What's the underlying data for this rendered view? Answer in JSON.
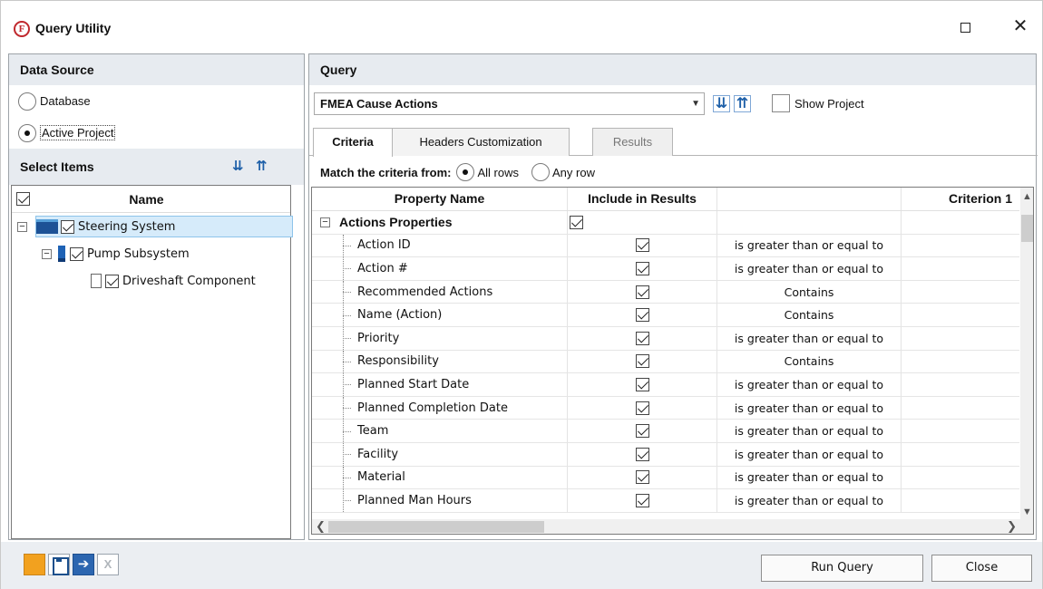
{
  "window": {
    "title": "Query Utility",
    "logo_letter": "F"
  },
  "data_source": {
    "heading": "Data Source",
    "options": [
      {
        "label": "Database",
        "selected": false
      },
      {
        "label": "Active Project",
        "selected": true
      }
    ]
  },
  "select_items": {
    "heading": "Select Items",
    "column_name": "Name",
    "tree": [
      {
        "label": "Steering System",
        "level": 0,
        "checked": true,
        "expanded": true,
        "selected": true,
        "icon": "folder-icon"
      },
      {
        "label": "Pump Subsystem",
        "level": 1,
        "checked": true,
        "expanded": true,
        "selected": false,
        "icon": "subsystem-icon"
      },
      {
        "label": "Driveshaft Component",
        "level": 2,
        "checked": true,
        "expanded": false,
        "selected": false,
        "icon": "component-icon"
      }
    ]
  },
  "query": {
    "heading": "Query",
    "selected_query": "FMEA Cause Actions",
    "show_project_label": "Show Project",
    "show_project_checked": false
  },
  "tabs": [
    {
      "label": "Criteria",
      "active": true,
      "enabled": true
    },
    {
      "label": "Headers Customization",
      "active": false,
      "enabled": true
    },
    {
      "label": "Results",
      "active": false,
      "enabled": false
    }
  ],
  "match": {
    "label": "Match the criteria from:",
    "options": [
      {
        "label": "All rows",
        "selected": true
      },
      {
        "label": "Any row",
        "selected": false
      }
    ]
  },
  "grid": {
    "columns": [
      "Property Name",
      "Include in Results",
      "",
      "Criterion 1"
    ],
    "group": {
      "label": "Actions Properties",
      "include": true
    },
    "rows": [
      {
        "property": "Action ID",
        "include": true,
        "criterion": "is greater than or equal to"
      },
      {
        "property": "Action #",
        "include": true,
        "criterion": "is greater than or equal to"
      },
      {
        "property": "Recommended Actions",
        "include": true,
        "criterion": "Contains"
      },
      {
        "property": "Name (Action)",
        "include": true,
        "criterion": "Contains"
      },
      {
        "property": "Priority",
        "include": true,
        "criterion": "is greater than or equal to"
      },
      {
        "property": "Responsibility",
        "include": true,
        "criterion": "Contains"
      },
      {
        "property": "Planned Start Date",
        "include": true,
        "criterion": "is greater than or equal to"
      },
      {
        "property": "Planned Completion Date",
        "include": true,
        "criterion": "is greater than or equal to"
      },
      {
        "property": "Team",
        "include": true,
        "criterion": "is greater than or equal to"
      },
      {
        "property": "Facility",
        "include": true,
        "criterion": "is greater than or equal to"
      },
      {
        "property": "Material",
        "include": true,
        "criterion": "is greater than or equal to"
      },
      {
        "property": "Planned Man Hours",
        "include": true,
        "criterion": "is greater than or equal to"
      }
    ]
  },
  "buttons": {
    "run_query": "Run Query",
    "close": "Close"
  },
  "colors": {
    "header_bg": "#e7ebf0",
    "accent_blue": "#1d5fa8",
    "logo_red": "#c0282d",
    "selection": "#d6ebfa"
  }
}
